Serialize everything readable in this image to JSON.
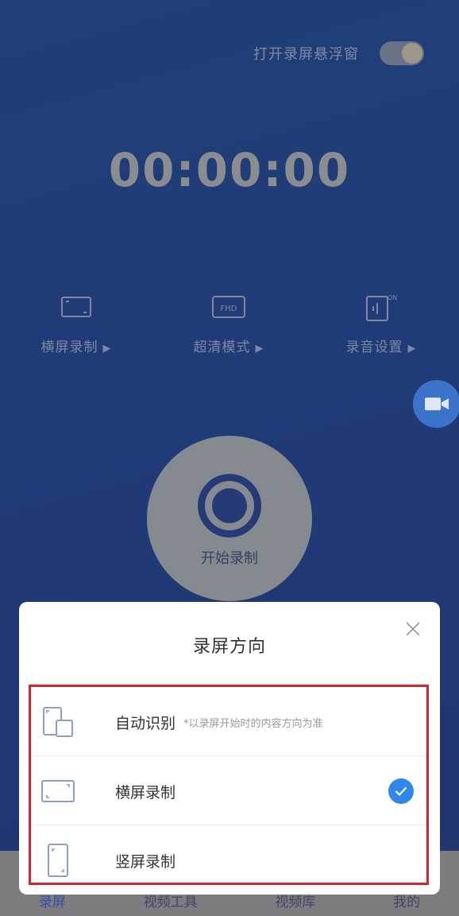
{
  "float_toggle": {
    "label": "打开录屏悬浮窗",
    "on": true
  },
  "timer": "00:00:00",
  "options": [
    {
      "label": "横屏录制",
      "icon": "landscape-icon"
    },
    {
      "label": "超清模式",
      "icon": "fhd-icon"
    },
    {
      "label": "录音设置",
      "icon": "mic-on-icon"
    }
  ],
  "record_button": {
    "label": "开始录制"
  },
  "bottom_nav": [
    "录屏",
    "视频工具",
    "视频库",
    "我的"
  ],
  "sheet": {
    "title": "录屏方向",
    "items": [
      {
        "label": "自动识别",
        "hint": "*以录屏开始时的内容方向为准",
        "icon": "auto-rotate-icon",
        "selected": false
      },
      {
        "label": "横屏录制",
        "hint": "",
        "icon": "landscape-icon",
        "selected": true
      },
      {
        "label": "竖屏录制",
        "hint": "",
        "icon": "portrait-icon",
        "selected": false
      }
    ]
  },
  "colors": {
    "accent": "#2f87ea",
    "highlight_border": "#d3262b",
    "float_bubble": "#3a73c9"
  }
}
